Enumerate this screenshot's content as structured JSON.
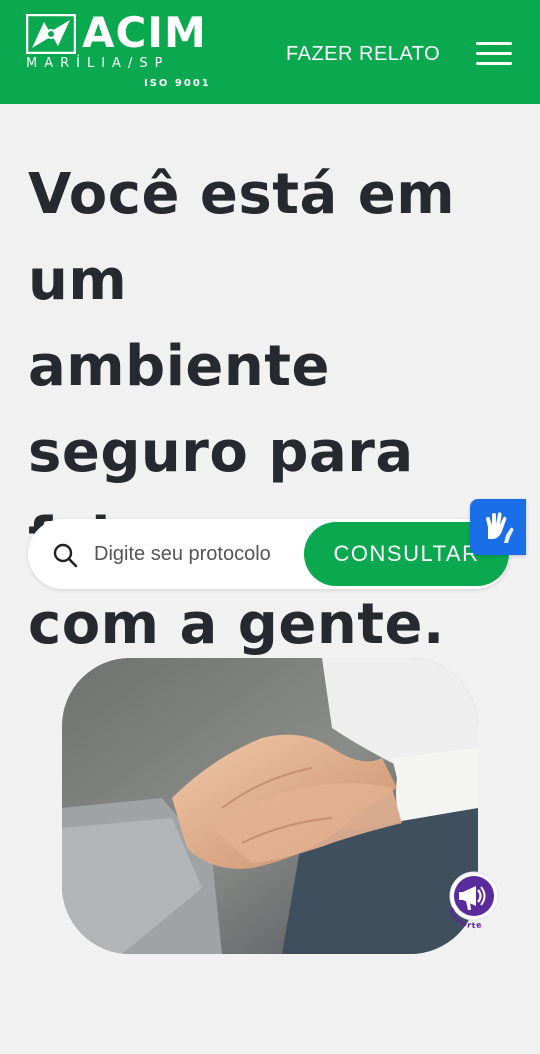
{
  "header": {
    "logo": {
      "name": "ACIM",
      "city": "MARÍLIA/SP",
      "certification": "ISO 9001"
    },
    "nav_link": "FAZER RELATO",
    "menu_icon": "hamburger-menu-icon",
    "background_color": "#0aa84f"
  },
  "hero": {
    "title": "Você está em um\nambiente\nseguro para falar\ncom a gente."
  },
  "search": {
    "icon": "search-icon",
    "placeholder": "Digite seu protocolo",
    "button_label": "CONSULTAR"
  },
  "accessibility": {
    "icon": "sign-language-hands-icon",
    "color": "#1a6fe8"
  },
  "widget": {
    "label": "Reporte",
    "icon": "megaphone-icon",
    "color": "#5b2b9e"
  },
  "image": {
    "subject": "photo-holding-hands"
  }
}
